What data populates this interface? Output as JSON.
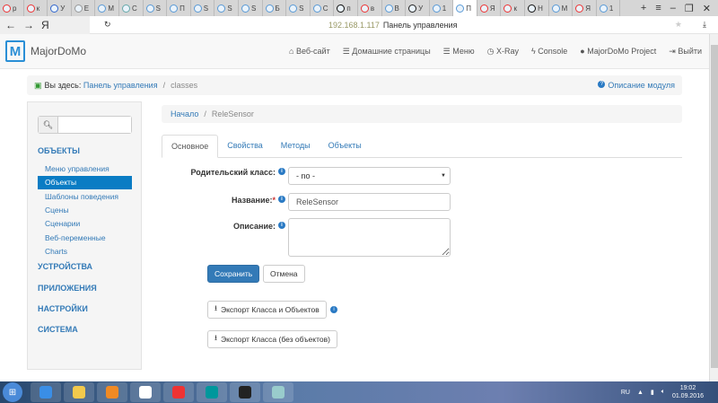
{
  "browser": {
    "tabs": [
      {
        "l": "р",
        "c": "#e33"
      },
      {
        "l": "к",
        "c": "#e33"
      },
      {
        "l": "У",
        "c": "#36c"
      },
      {
        "l": "E",
        "c": "#999"
      },
      {
        "l": "М",
        "c": "#5a9ad6"
      },
      {
        "l": "С",
        "c": "#6aa"
      },
      {
        "l": "S",
        "c": "#5a9ad6"
      },
      {
        "l": "П",
        "c": "#5a9ad6"
      },
      {
        "l": "S",
        "c": "#5a9ad6"
      },
      {
        "l": "S",
        "c": "#5a9ad6"
      },
      {
        "l": "S",
        "c": "#5a9ad6"
      },
      {
        "l": "Б",
        "c": "#5a9ad6"
      },
      {
        "l": "S",
        "c": "#5a9ad6"
      },
      {
        "l": "С",
        "c": "#5a9ad6"
      },
      {
        "l": "п",
        "c": "#111"
      },
      {
        "l": "в",
        "c": "#e33"
      },
      {
        "l": "В",
        "c": "#5a9ad6"
      },
      {
        "l": "У",
        "c": "#222"
      },
      {
        "l": "1",
        "c": "#5a9ad6"
      },
      {
        "l": "П",
        "c": "#5a9ad6",
        "active": true
      },
      {
        "l": "Я",
        "c": "#e33"
      },
      {
        "l": "к",
        "c": "#e33"
      },
      {
        "l": "Н",
        "c": "#111"
      },
      {
        "l": "М",
        "c": "#5a9ad6"
      },
      {
        "l": "Я",
        "c": "#e33"
      },
      {
        "l": "1",
        "c": "#5a9ad6"
      }
    ],
    "ip": "192.168.1.117",
    "page_title": "Панель управления",
    "yandex": "Я"
  },
  "header": {
    "logo_letter": "M",
    "brand": "MajorDoMo",
    "nav": [
      {
        "icon": "home-icon",
        "g": "⌂",
        "label": "Веб-сайт"
      },
      {
        "icon": "list-icon",
        "g": "☰",
        "label": "Домашние страницы"
      },
      {
        "icon": "list-icon",
        "g": "☰",
        "label": "Меню"
      },
      {
        "icon": "clock-icon",
        "g": "◷",
        "label": "X-Ray"
      },
      {
        "icon": "bolt-icon",
        "g": "ϟ",
        "label": "Console"
      },
      {
        "icon": "globe-icon",
        "g": "●",
        "label": "MajorDoMo Project"
      },
      {
        "icon": "logout-icon",
        "g": "⇥",
        "label": "Выйти"
      }
    ]
  },
  "crumb": {
    "prefix": "Вы здесь:",
    "link": "Панель управления",
    "sep": "/",
    "current": "classes",
    "help": "Описание модуля"
  },
  "sidebar": {
    "search_placeholder": "",
    "sections": [
      "ОБЪЕКТЫ",
      "УСТРОЙСТВА",
      "ПРИЛОЖЕНИЯ",
      "НАСТРОЙКИ",
      "СИСТЕМА"
    ],
    "items": [
      {
        "label": "Меню управления"
      },
      {
        "label": "Объекты",
        "active": true
      },
      {
        "label": "Шаблоны поведения"
      },
      {
        "label": "Сцены"
      },
      {
        "label": "Сценарии"
      },
      {
        "label": "Веб-переменные"
      },
      {
        "label": "Charts"
      }
    ]
  },
  "content": {
    "crumb_home": "Начало",
    "crumb_sep": "/",
    "crumb_current": "ReleSensor",
    "tabs": [
      "Основное",
      "Свойства",
      "Методы",
      "Объекты"
    ],
    "form": {
      "parent_label": "Родительский класс:",
      "parent_value": "- no -",
      "name_label": "Название:",
      "required": "*",
      "name_value": "ReleSensor",
      "desc_label": "Описание:",
      "desc_value": ""
    },
    "save": "Сохранить",
    "cancel": "Отмена",
    "export_all": "Экспорт Класса и Объектов",
    "export_class": "Экспорт Класса (без объектов)"
  },
  "taskbar": {
    "lang": "RU",
    "time": "19:02",
    "date": "01.09.2016",
    "apps": [
      {
        "n": "ie",
        "c": "#3a8ee6"
      },
      {
        "n": "explorer",
        "c": "#f2c94c"
      },
      {
        "n": "player",
        "c": "#f08a24"
      },
      {
        "n": "yandex",
        "c": "#fff"
      },
      {
        "n": "yandex-browser",
        "c": "#e33"
      },
      {
        "n": "arduino",
        "c": "#00979c"
      },
      {
        "n": "camera",
        "c": "#222"
      },
      {
        "n": "paint",
        "c": "#9cc"
      }
    ]
  }
}
